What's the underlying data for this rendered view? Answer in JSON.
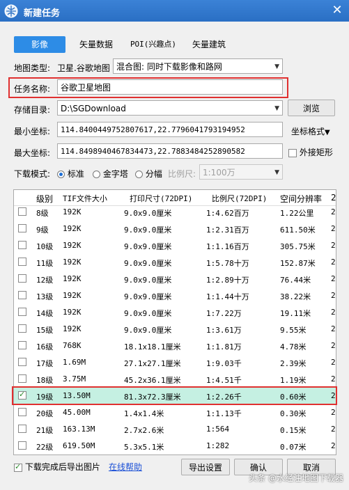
{
  "window": {
    "title": "新建任务"
  },
  "tabs": [
    {
      "label": "影像",
      "active": true
    },
    {
      "label": "矢量数据",
      "active": false
    },
    {
      "label": "POI(兴趣点)",
      "active": false
    },
    {
      "label": "矢量建筑",
      "active": false
    }
  ],
  "form": {
    "map_type_label": "地图类型:",
    "map_type_value": "卫星.谷歌地图",
    "map_mode_value": "混合图: 同时下载影像和路网",
    "task_name_label": "任务名称:",
    "task_name_value": "谷歌卫星地图",
    "storage_label": "存储目录:",
    "storage_value": "D:\\SGDownload",
    "browse_label": "浏览",
    "min_coord_label": "最小坐标:",
    "min_coord_value": "114.8400449752807617,22.7796041793194952",
    "coord_format_label": "坐标格式",
    "max_coord_label": "最大坐标:",
    "max_coord_value": "114.8498940467834473,22.7883484252890582",
    "bbox_label": "外接矩形",
    "download_mode_label": "下载模式:",
    "mode_standard": "标准",
    "mode_pyramid": "金字塔",
    "mode_tile": "分幅",
    "scale_label": "比例尺:",
    "scale_value": "1:100万"
  },
  "table": {
    "headers": [
      "级别",
      "TIF文件大小",
      "打印尺寸(72DPI)",
      "比例尺(72DPI)",
      "空间分辨率",
      "2"
    ],
    "rows": [
      {
        "level": "8级",
        "size": "192K",
        "print": "9.0x9.0厘米",
        "scale": "1:4.62百万",
        "res": "1.22公里",
        "extra": "2",
        "checked": false,
        "selected": false
      },
      {
        "level": "9级",
        "size": "192K",
        "print": "9.0x9.0厘米",
        "scale": "1:2.31百万",
        "res": "611.50米",
        "extra": "2",
        "checked": false,
        "selected": false
      },
      {
        "level": "10级",
        "size": "192K",
        "print": "9.0x9.0厘米",
        "scale": "1:1.16百万",
        "res": "305.75米",
        "extra": "2",
        "checked": false,
        "selected": false
      },
      {
        "level": "11级",
        "size": "192K",
        "print": "9.0x9.0厘米",
        "scale": "1:5.78十万",
        "res": "152.87米",
        "extra": "2",
        "checked": false,
        "selected": false
      },
      {
        "level": "12级",
        "size": "192K",
        "print": "9.0x9.0厘米",
        "scale": "1:2.89十万",
        "res": "76.44米",
        "extra": "2",
        "checked": false,
        "selected": false
      },
      {
        "level": "13级",
        "size": "192K",
        "print": "9.0x9.0厘米",
        "scale": "1:1.44十万",
        "res": "38.22米",
        "extra": "2",
        "checked": false,
        "selected": false
      },
      {
        "level": "14级",
        "size": "192K",
        "print": "9.0x9.0厘米",
        "scale": "1:7.22万",
        "res": "19.11米",
        "extra": "2",
        "checked": false,
        "selected": false
      },
      {
        "level": "15级",
        "size": "192K",
        "print": "9.0x9.0厘米",
        "scale": "1:3.61万",
        "res": "9.55米",
        "extra": "2",
        "checked": false,
        "selected": false
      },
      {
        "level": "16级",
        "size": "768K",
        "print": "18.1x18.1厘米",
        "scale": "1:1.81万",
        "res": "4.78米",
        "extra": "2",
        "checked": false,
        "selected": false
      },
      {
        "level": "17级",
        "size": "1.69M",
        "print": "27.1x27.1厘米",
        "scale": "1:9.03千",
        "res": "2.39米",
        "extra": "2",
        "checked": false,
        "selected": false
      },
      {
        "level": "18级",
        "size": "3.75M",
        "print": "45.2x36.1厘米",
        "scale": "1:4.51千",
        "res": "1.19米",
        "extra": "2",
        "checked": false,
        "selected": false
      },
      {
        "level": "19级",
        "size": "13.50M",
        "print": "81.3x72.3厘米",
        "scale": "1:2.26千",
        "res": "0.60米",
        "extra": "2",
        "checked": true,
        "selected": true
      },
      {
        "level": "20级",
        "size": "45.00M",
        "print": "1.4x1.4米",
        "scale": "1:1.13千",
        "res": "0.30米",
        "extra": "2",
        "checked": false,
        "selected": false
      },
      {
        "level": "21级",
        "size": "163.13M",
        "print": "2.7x2.6米",
        "scale": "1:564",
        "res": "0.15米",
        "extra": "2",
        "checked": false,
        "selected": false
      },
      {
        "level": "22级",
        "size": "619.50M",
        "print": "5.3x5.1米",
        "scale": "1:282",
        "res": "0.07米",
        "extra": "2",
        "checked": false,
        "selected": false
      }
    ]
  },
  "footer": {
    "export_label": "下载完成后导出图片",
    "help_link": "在线帮助",
    "export_settings": "导出设置",
    "confirm": "确认",
    "cancel": "取消"
  },
  "watermark": "头条 @水经注地图下载器"
}
